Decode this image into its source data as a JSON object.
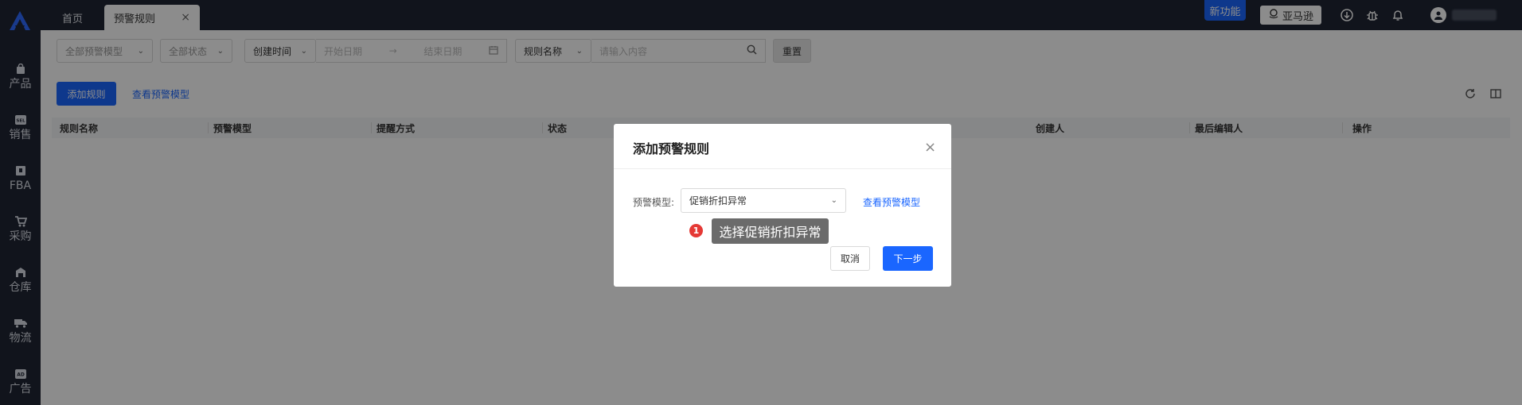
{
  "sidebar": {
    "items": [
      {
        "label": "产品",
        "icon": "bag-icon"
      },
      {
        "label": "销售",
        "icon": "sell-icon"
      },
      {
        "label": "FBA",
        "icon": "box-icon"
      },
      {
        "label": "采购",
        "icon": "cart-icon"
      },
      {
        "label": "仓库",
        "icon": "warehouse-icon"
      },
      {
        "label": "物流",
        "icon": "truck-icon"
      },
      {
        "label": "广告",
        "icon": "ad-icon"
      }
    ]
  },
  "header": {
    "tabs": [
      {
        "label": "首页"
      },
      {
        "label": "预警规则",
        "close": "×"
      }
    ],
    "new_feature": "新功能",
    "amazon_label": "亚马逊",
    "icons": [
      "download-icon",
      "bug-icon",
      "bell-icon",
      "user-icon"
    ]
  },
  "filters": {
    "model_select": "全部预警模型",
    "status_select": "全部状态",
    "time_type": "创建时间",
    "start_date": "开始日期",
    "end_date": "结束日期",
    "date_arrow": "→",
    "search_field": "规则名称",
    "search_placeholder": "请输入内容",
    "reset": "重置"
  },
  "toolbar": {
    "add_rule": "添加规则",
    "view_model": "查看预警模型"
  },
  "table": {
    "columns": [
      "规则名称",
      "预警模型",
      "提醒方式",
      "状态",
      "创建人",
      "最后编辑人",
      "操作"
    ]
  },
  "modal": {
    "title": "添加预警规则",
    "close": "×",
    "field_label": "预警模型:",
    "selected_model": "促销折扣异常",
    "view_model_link": "查看预警模型",
    "cancel": "取消",
    "next": "下一步"
  },
  "hint": {
    "step": "1",
    "text": "选择促销折扣异常"
  },
  "colors": {
    "primary": "#1a66ff",
    "sidebar_bg": "#1f2533",
    "hint_dot": "#e53935"
  }
}
